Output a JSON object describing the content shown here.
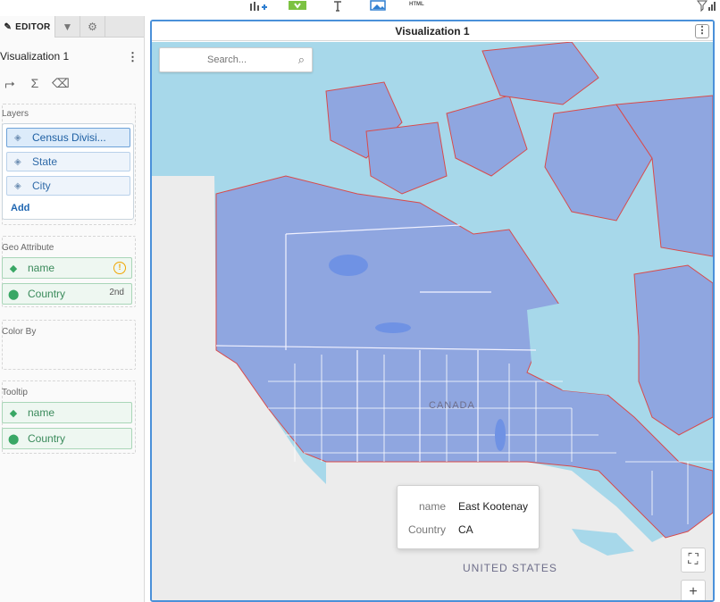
{
  "toolbar": {
    "html_label": "HTML"
  },
  "editor": {
    "tabs": {
      "editor_label": "EDITOR"
    },
    "visualization_name": "Visualization 1",
    "layers_label": "Layers",
    "layers": [
      {
        "label": "Census Divisi..."
      },
      {
        "label": "State"
      },
      {
        "label": "City"
      }
    ],
    "add_label": "Add",
    "geo_attribute_label": "Geo Attribute",
    "geo_attributes": [
      {
        "label": "name"
      },
      {
        "label": "Country",
        "suffix": "2nd"
      }
    ],
    "color_by_label": "Color By",
    "tooltip_label": "Tooltip",
    "tooltip_fields": [
      {
        "label": "name"
      },
      {
        "label": "Country"
      }
    ]
  },
  "visualization": {
    "title": "Visualization 1",
    "search_placeholder": "Search...",
    "map_labels": {
      "canada": "CANADA",
      "united_states": "UNITED STATES"
    },
    "tooltip": {
      "rows": [
        {
          "key": "name",
          "value": "East Kootenay"
        },
        {
          "key": "Country",
          "value": "CA"
        }
      ]
    }
  },
  "colors": {
    "accent": "#4a90d9",
    "water": "#a7d8ea",
    "canada_fill": "#8fa6e0",
    "region_border": "#d94a4a",
    "land": "#ececec"
  }
}
